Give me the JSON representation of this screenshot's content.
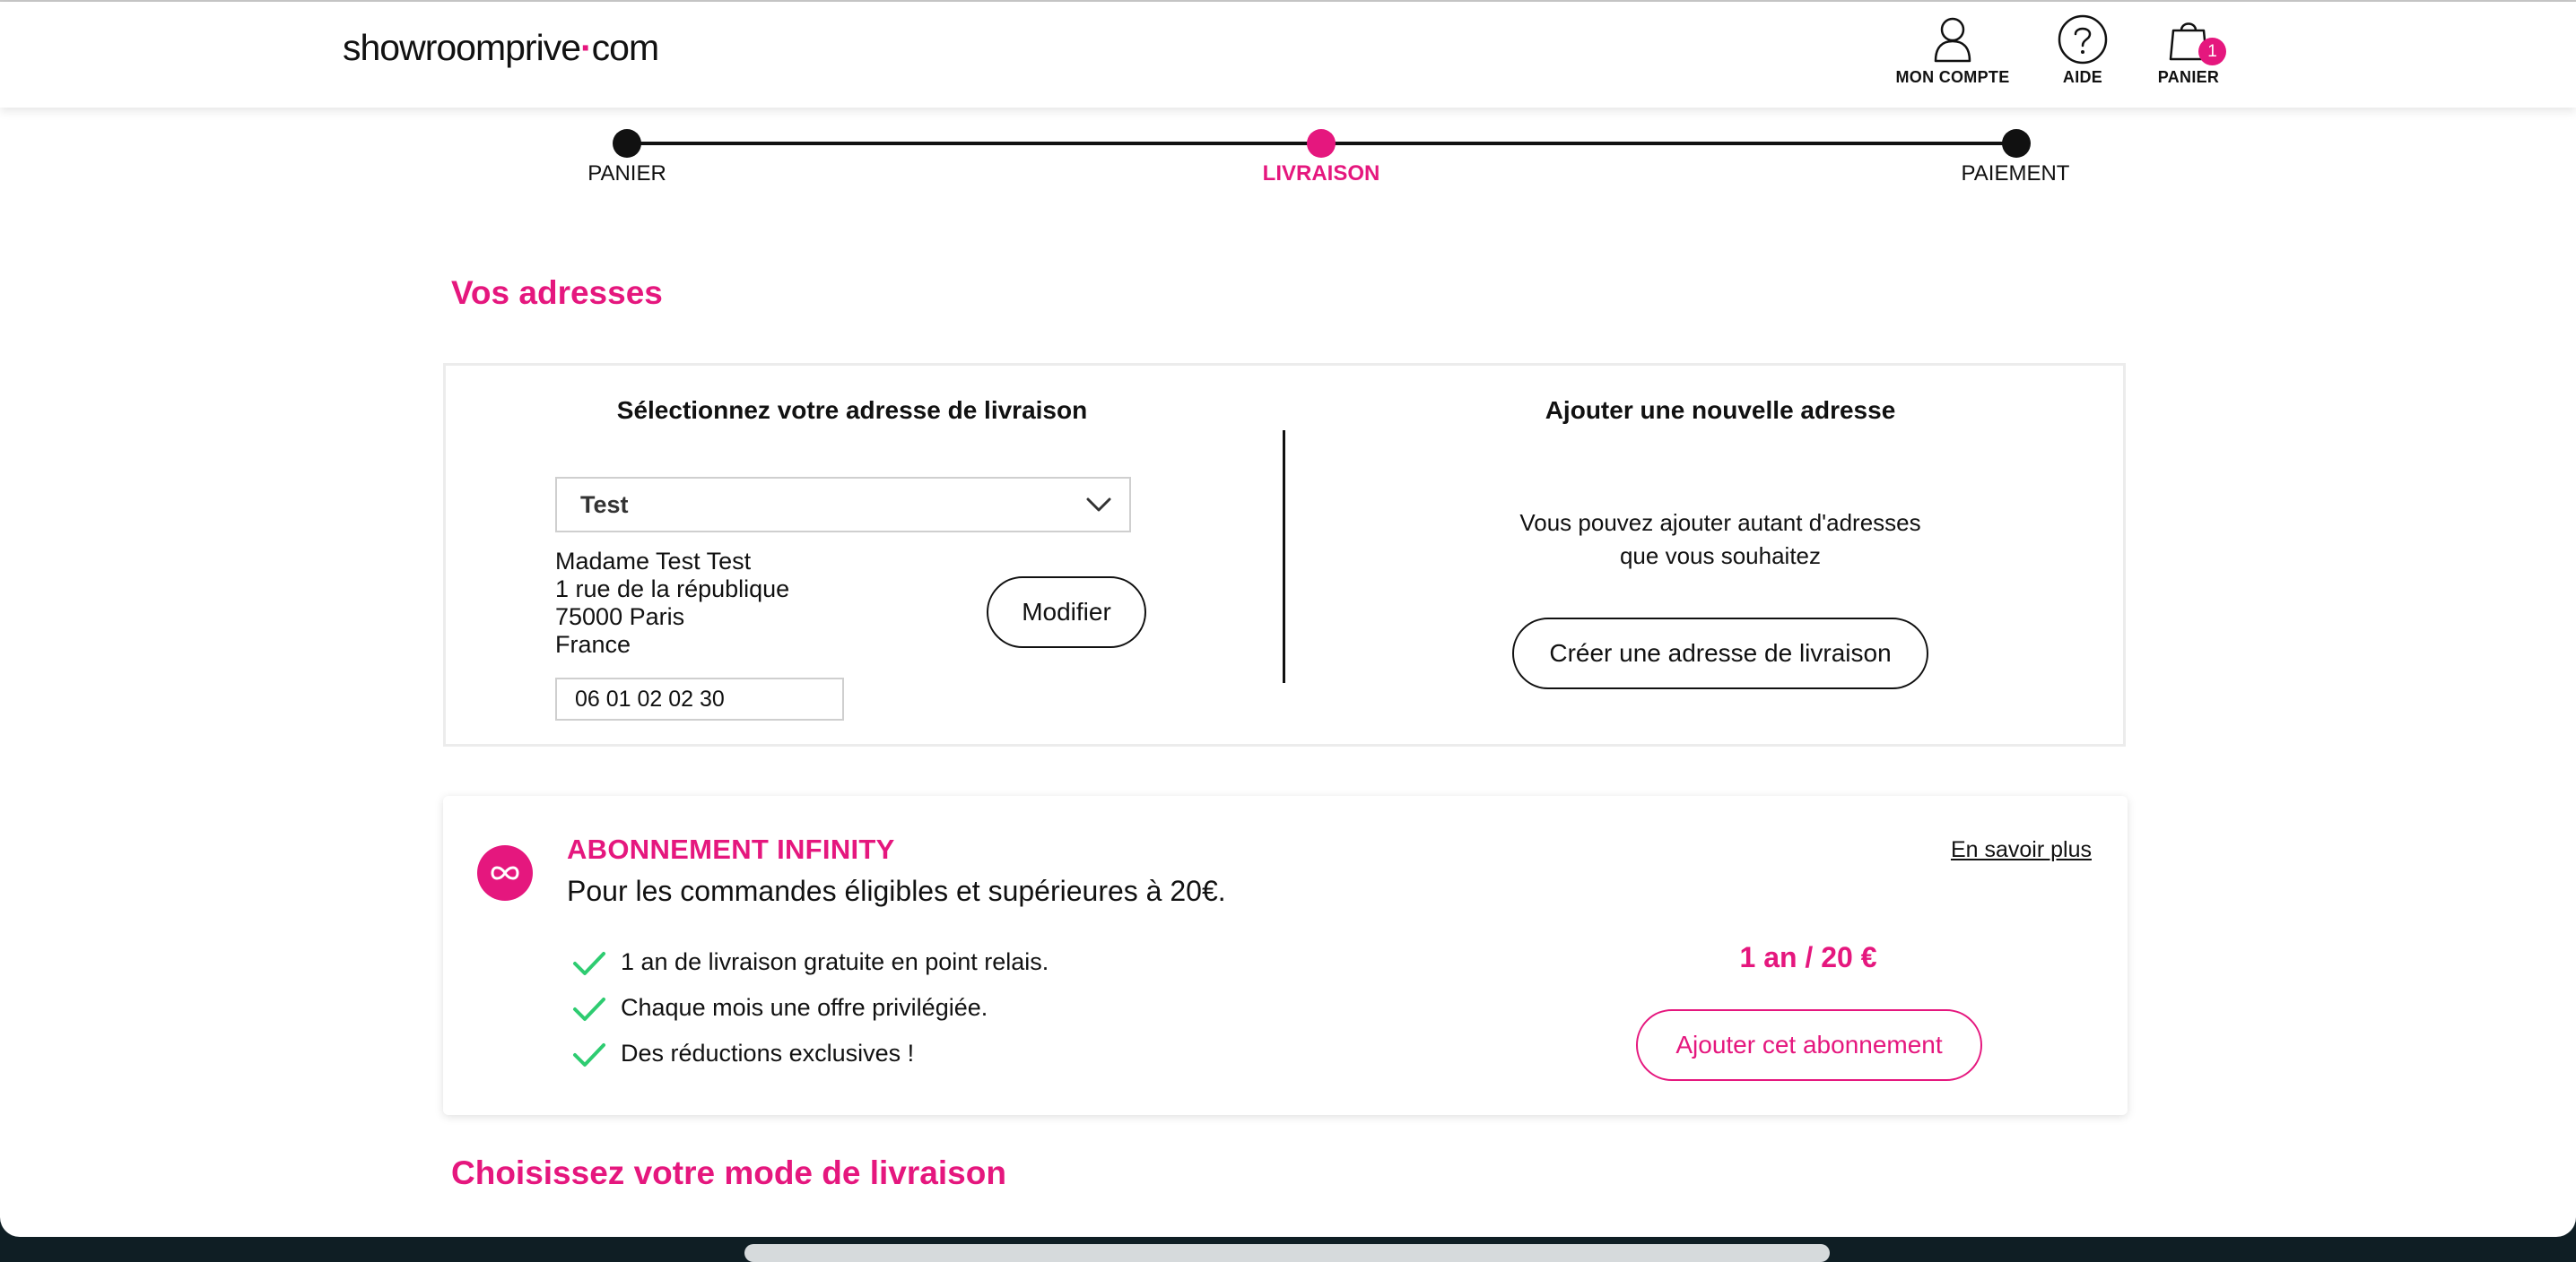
{
  "header": {
    "logo_main": "showroomprive",
    "logo_dot": "·",
    "logo_suffix": "com",
    "account_label": "MON COMPTE",
    "help_label": "AIDE",
    "cart_label": "PANIER",
    "cart_count": "1",
    "icons": {
      "account": "user-icon",
      "help": "question-icon",
      "cart": "shopping-bag-icon"
    }
  },
  "stepper": {
    "steps": [
      {
        "label": "PANIER",
        "active": false
      },
      {
        "label": "LIVRAISON",
        "active": true
      },
      {
        "label": "PAIEMENT",
        "active": false
      }
    ]
  },
  "addresses": {
    "section_title": "Vos adresses",
    "select_heading": "Sélectionnez votre adresse de livraison",
    "selected_value": "Test",
    "address_lines": [
      "Madame Test Test",
      "1 rue de la république",
      "75000 Paris",
      "France"
    ],
    "phone": "06 01 02 02 30",
    "modify_label": "Modifier",
    "add_heading": "Ajouter une nouvelle adresse",
    "add_help_line1": "Vous pouvez ajouter autant d'adresses",
    "add_help_line2": "que vous souhaitez",
    "create_label": "Créer une adresse de livraison"
  },
  "infinity": {
    "title": "ABONNEMENT INFINITY",
    "subtitle": "Pour les commandes éligibles et supérieures à 20€.",
    "benefits": [
      "1 an de livraison gratuite en point relais.",
      "Chaque mois une offre privilégiée.",
      "Des réductions exclusives !"
    ],
    "learn_more": "En savoir plus",
    "price": "1 an / 20 €",
    "subscribe_label": "Ajouter cet abonnement"
  },
  "delivery": {
    "section_title": "Choisissez votre mode de livraison"
  },
  "colors": {
    "accent": "#e5177e",
    "check": "#2ecc71",
    "text": "#111111"
  }
}
